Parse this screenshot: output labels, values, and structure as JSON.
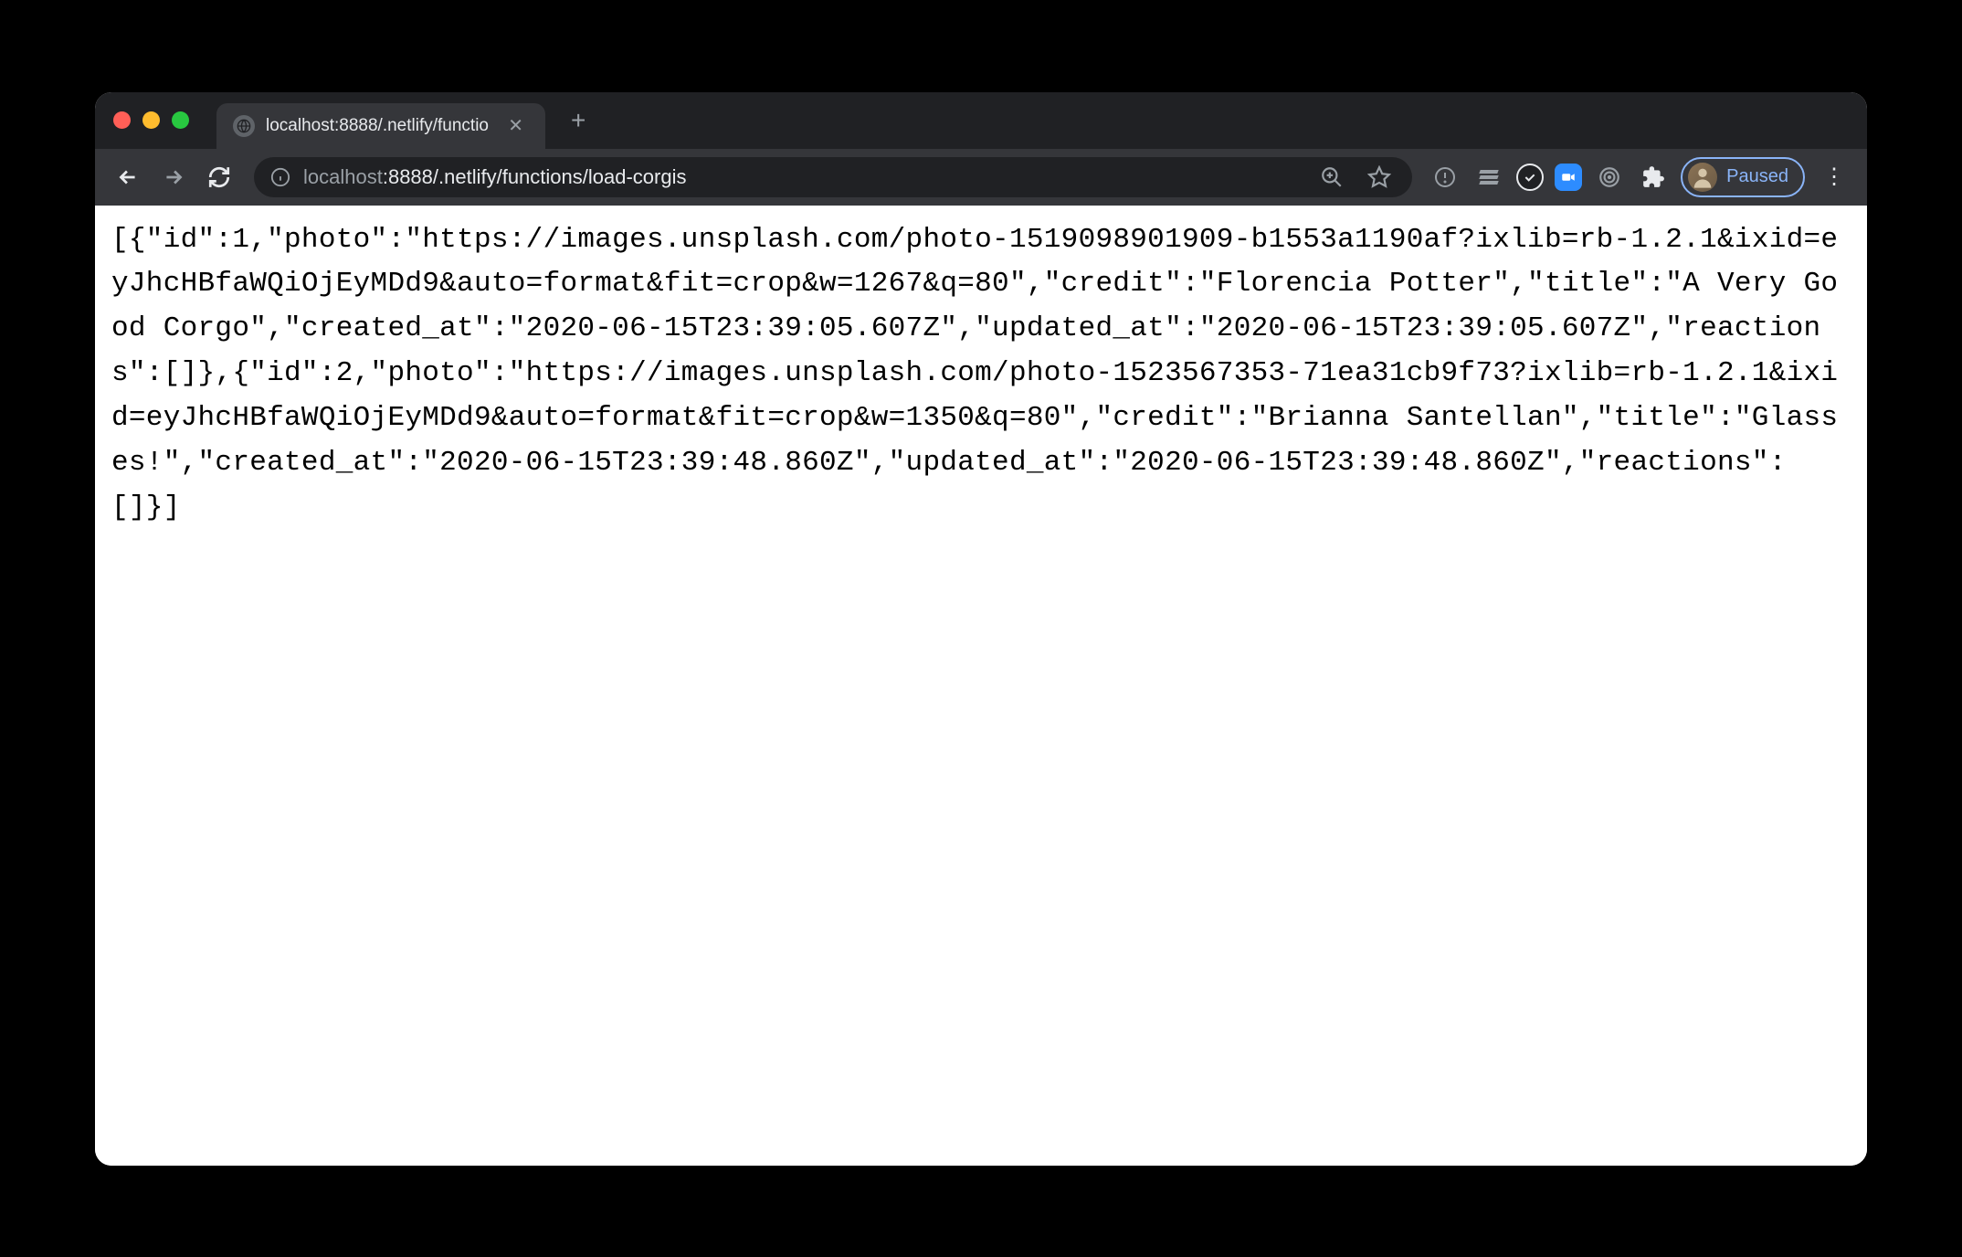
{
  "tab": {
    "title": "localhost:8888/.netlify/functio"
  },
  "url": {
    "host_dim": "localhost",
    "port_path": ":8888/.netlify/functions/load-corgis"
  },
  "profile": {
    "label": "Paused"
  },
  "body": {
    "json_text": "[{\"id\":1,\"photo\":\"https://images.unsplash.com/photo-1519098901909-b1553a1190af?ixlib=rb-1.2.1&ixid=eyJhcHBfaWQiOjEyMDd9&auto=format&fit=crop&w=1267&q=80\",\"credit\":\"Florencia Potter\",\"title\":\"A Very Good Corgo\",\"created_at\":\"2020-06-15T23:39:05.607Z\",\"updated_at\":\"2020-06-15T23:39:05.607Z\",\"reactions\":[]},{\"id\":2,\"photo\":\"https://images.unsplash.com/photo-1523567353-71ea31cb9f73?ixlib=rb-1.2.1&ixid=eyJhcHBfaWQiOjEyMDd9&auto=format&fit=crop&w=1350&q=80\",\"credit\":\"Brianna Santellan\",\"title\":\"Glasses!\",\"created_at\":\"2020-06-15T23:39:48.860Z\",\"updated_at\":\"2020-06-15T23:39:48.860Z\",\"reactions\":[]}]"
  }
}
